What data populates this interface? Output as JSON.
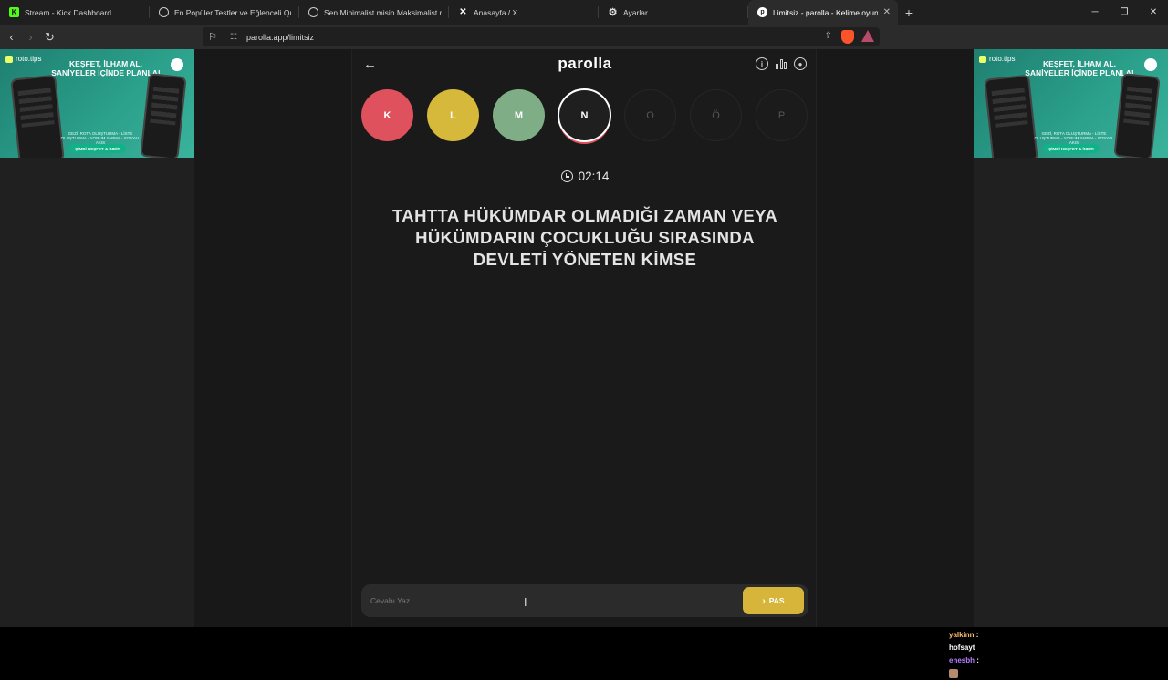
{
  "browser": {
    "tabs": [
      {
        "title": "Stream - Kick Dashboard",
        "icon": "kick-icon",
        "active": false
      },
      {
        "title": "En Popüler Testler ve Eğlenceli Quizler",
        "icon": "quiz-site-icon",
        "active": false
      },
      {
        "title": "Sen Minimalist misin Maksimalist mi?",
        "icon": "quiz-site-icon",
        "active": false
      },
      {
        "title": "Anasayfa / X",
        "icon": "x-icon",
        "active": false
      },
      {
        "title": "Ayarlar",
        "icon": "gear-icon",
        "active": false
      },
      {
        "title": "Limitsiz - parolla - Kelime oyunu",
        "icon": "parolla-icon",
        "active": true
      }
    ],
    "url": "parolla.app/limitsiz"
  },
  "ads": {
    "brand": "roto.tips",
    "headline": "KEŞFET, İLHAM AL. SANİYELER İÇİNDE PLANLA!",
    "small_text": "GEZİ, ROTA OLUŞTURMA - LİSTE OLUŞTURMA - YORUM YAPMA - SOSYAL AKIŞ",
    "cta": "ŞİMDİ KEŞFET & İNDİR"
  },
  "app": {
    "title": "parolla",
    "letters": [
      {
        "letter": "K",
        "state": "wrong"
      },
      {
        "letter": "L",
        "state": "pass"
      },
      {
        "letter": "M",
        "state": "right"
      },
      {
        "letter": "N",
        "state": "current"
      },
      {
        "letter": "O",
        "state": "empty"
      },
      {
        "letter": "Ö",
        "state": "empty"
      },
      {
        "letter": "P",
        "state": "empty"
      }
    ],
    "timer": "02:14",
    "question": "TAHTTA HÜKÜMDAR OLMADIĞI ZAMAN VEYA HÜKÜMDARIN ÇOCUKLUĞU SIRASINDA DEVLETİ YÖNETEN KİMSE",
    "answer_placeholder": "Cevabı Yaz",
    "answer_value": "",
    "pass_label": "PAS"
  },
  "chat": [
    {
      "user": "yalkinn",
      "message": "hofsayt"
    },
    {
      "user": "enesbh",
      "message": ""
    }
  ],
  "colors": {
    "wrong": "#e0515e",
    "pass": "#d6b83a",
    "right": "#7fae86"
  }
}
